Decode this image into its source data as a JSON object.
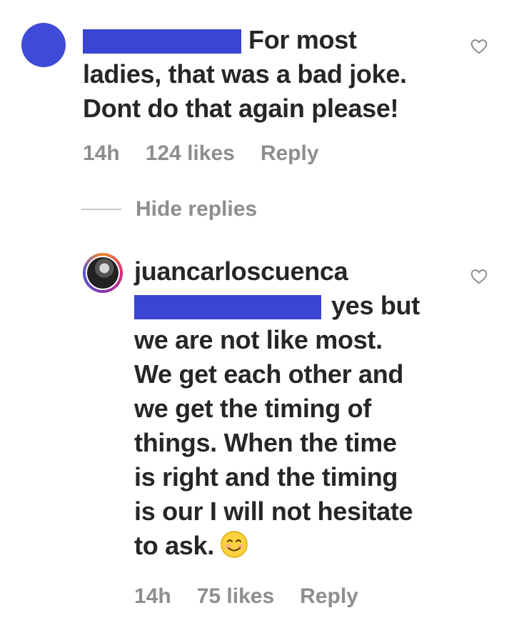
{
  "comments": [
    {
      "text": "For most ladies, that was a bad joke. Dont do that again please!",
      "line1": "For most",
      "line2": "ladies, that was a bad joke.",
      "line3": "Dont do that again please!",
      "time": "14h",
      "likes": "124 likes",
      "reply_label": "Reply"
    }
  ],
  "hide_replies_label": "Hide replies",
  "reply": {
    "username": "juancarloscuenca",
    "line1": "yes but",
    "line2": "we are not like most.",
    "line3": "We get each other and",
    "line4": "we get the timing of",
    "line5": "things. When the time",
    "line6": "is right and the timing",
    "line7": "is our I will not hesitate",
    "line8": "to ask.",
    "emoji": "smiling-face",
    "time": "14h",
    "likes": "75 likes",
    "reply_label": "Reply"
  },
  "colors": {
    "redaction": "#3a45d4",
    "text": "#262626",
    "meta": "#8e8e8e"
  }
}
